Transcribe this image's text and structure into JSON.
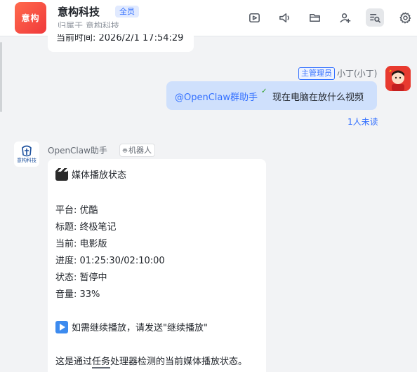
{
  "header": {
    "group_avatar_text": "意构",
    "title": "意构科技",
    "tag": "全员",
    "subtitle": "归属于 意构科技",
    "tools": [
      "video-chat-icon",
      "announcement-icon",
      "folder-icon",
      "add-member-icon",
      "search-chat-icon",
      "settings-icon"
    ]
  },
  "previous_message": {
    "text": "当前时间: 2026/2/1 17:54:29"
  },
  "user_message": {
    "role_badge": "主管理员",
    "sender": "小丁(小丁)",
    "mention": "@OpenClaw群助手",
    "text": "现在电脑在放什么视频",
    "read_status": "1人未读"
  },
  "bot_message": {
    "sender": "OpenClaw助手",
    "badge": "机器人",
    "avatar_text": "意构科技",
    "heading": "媒体播放状态",
    "lines": {
      "platform": "平台: 优酷",
      "title": "标题: 终极笔记",
      "current": "当前: 电影版",
      "progress": "进度: 01:25:30/02:10:00",
      "status": "状态: 暂停中",
      "volume": "音量: 33%"
    },
    "hint": "如需继续播放，请发送\"继续播放\"",
    "footer_pre": "这是通过",
    "footer_underlined": "任务",
    "footer_post": "处理器检测的当前媒体播放状态。"
  },
  "colors": {
    "accent": "#3370ff",
    "bubble_self": "#cfe0fc",
    "background": "#f2f3f5"
  }
}
